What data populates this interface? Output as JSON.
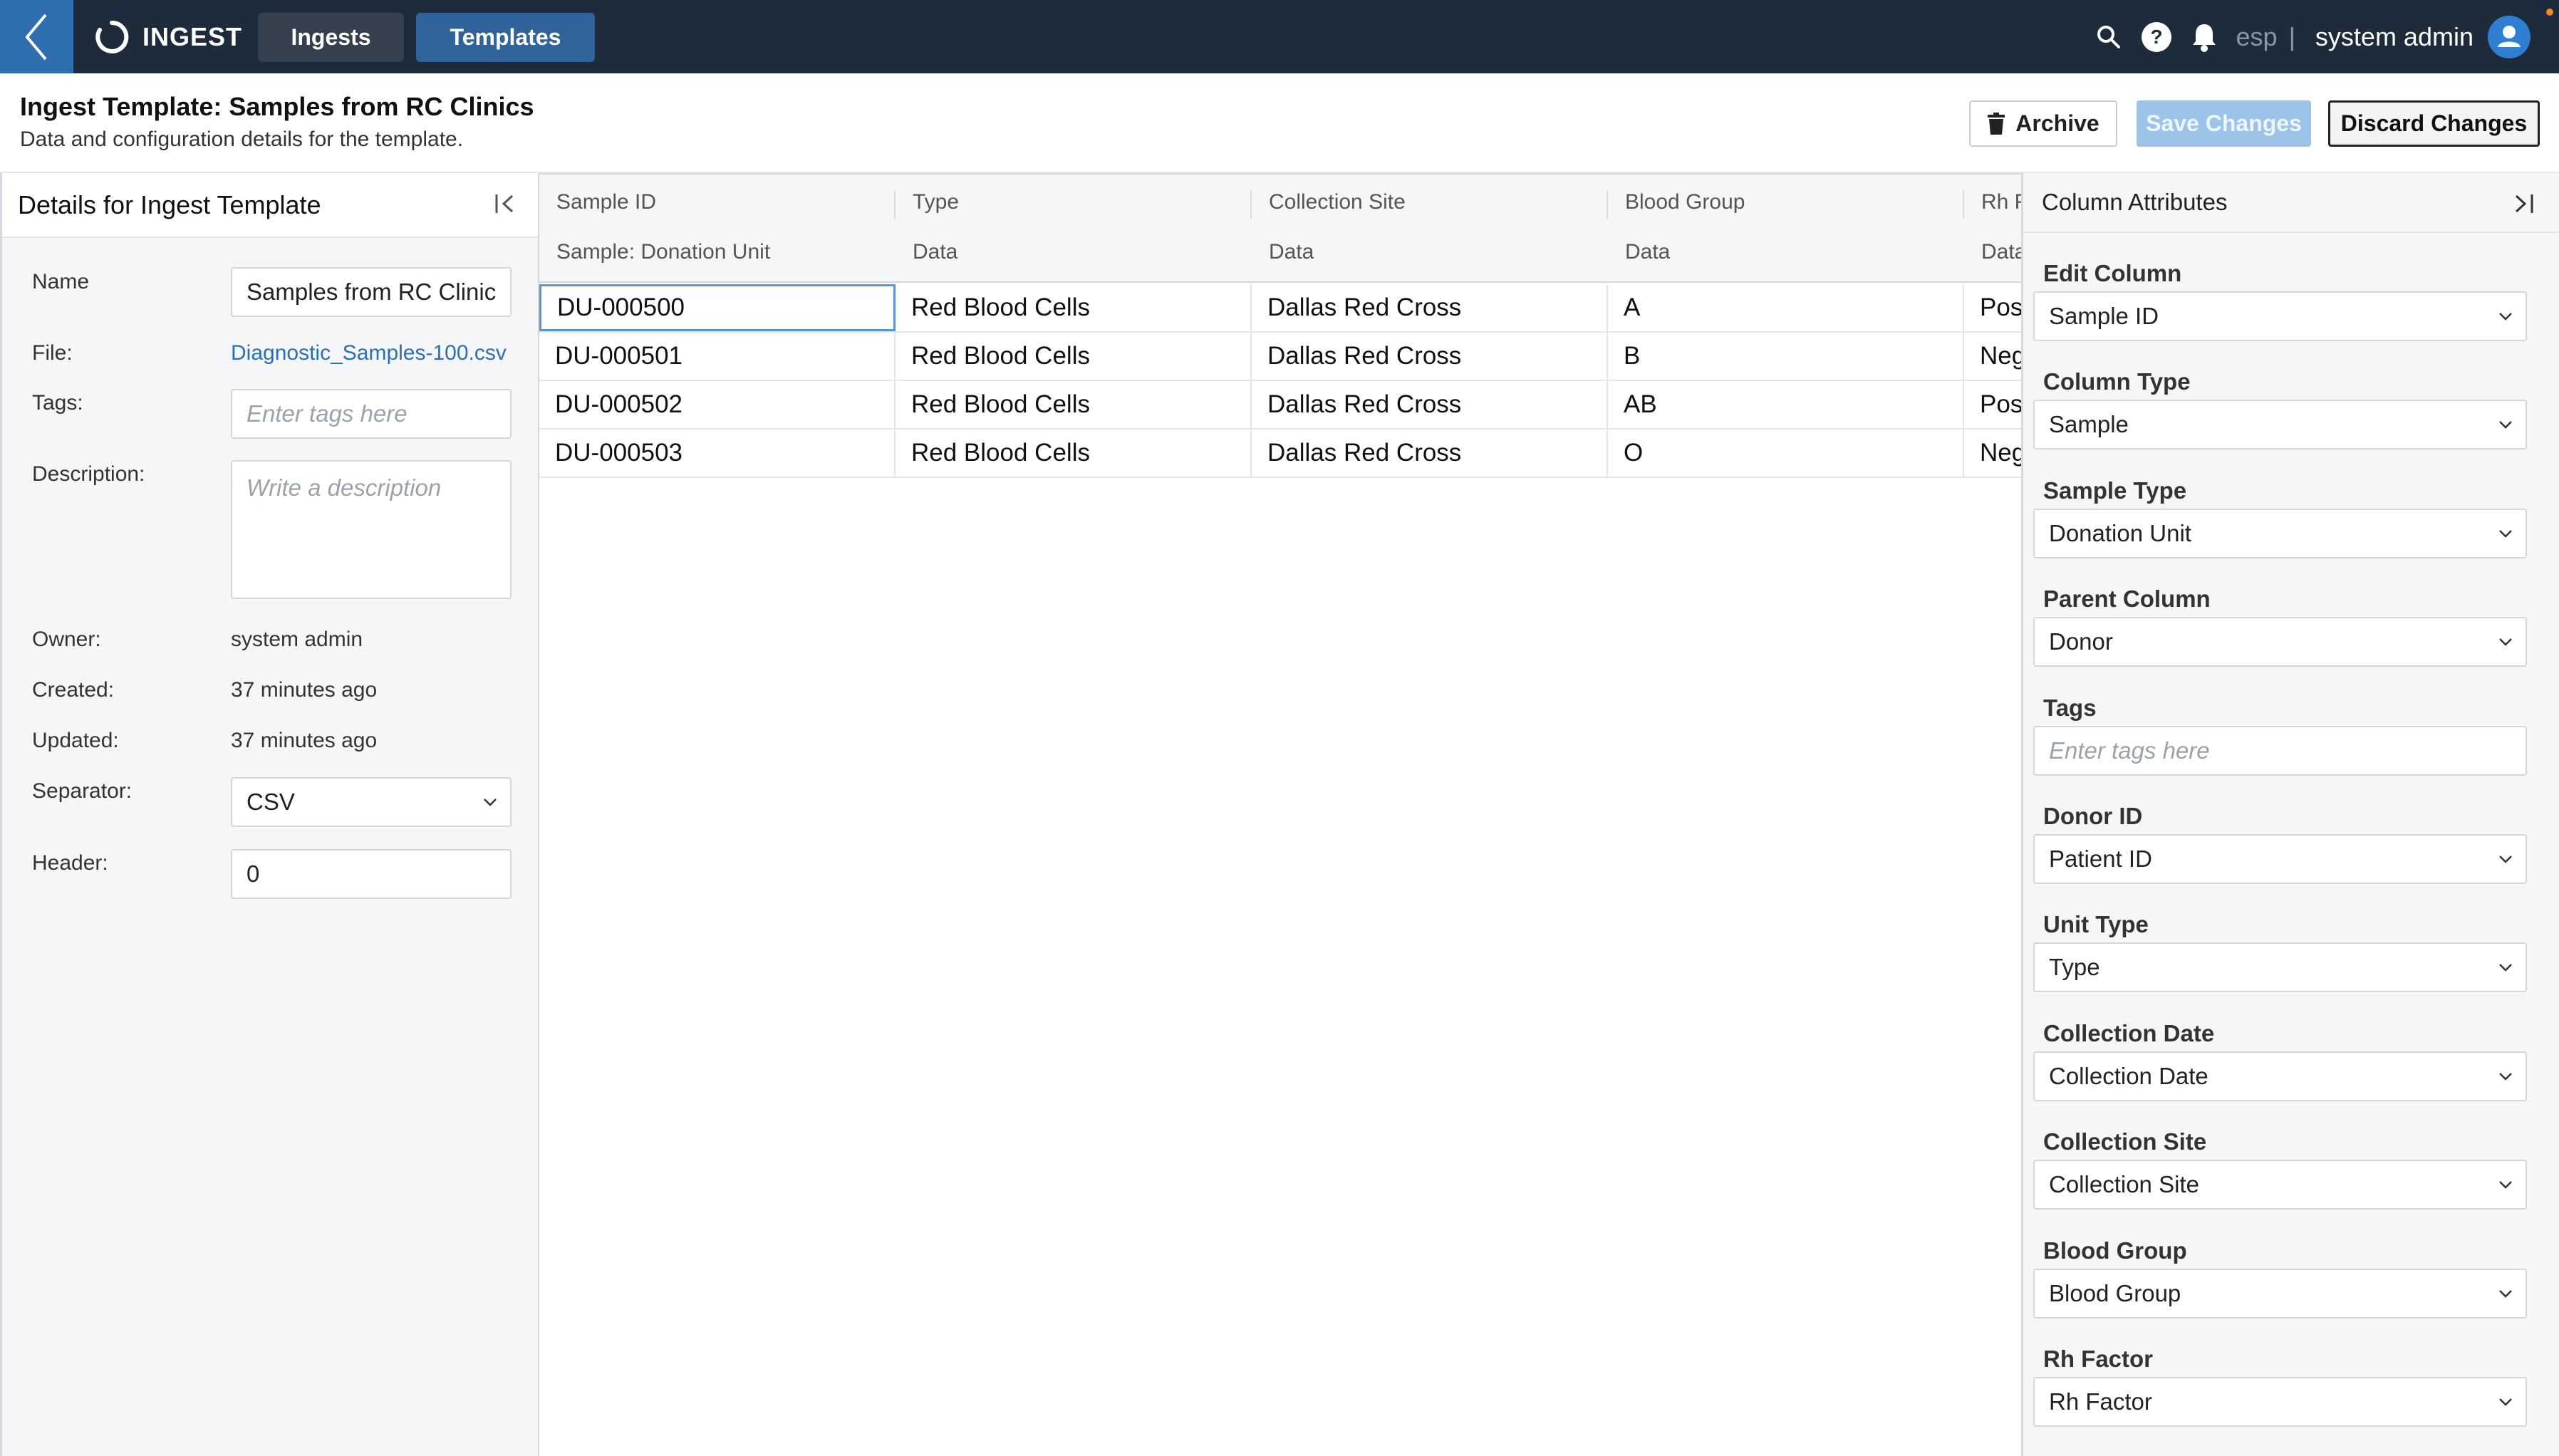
{
  "navbar": {
    "brand": "INGEST",
    "tabs": [
      {
        "label": "Ingests",
        "active": false
      },
      {
        "label": "Templates",
        "active": true
      }
    ],
    "environment": "esp",
    "separator": "|",
    "user_name": "system admin"
  },
  "page": {
    "title": "Ingest Template: Samples from RC Clinics",
    "subtitle": "Data and configuration details for the template.",
    "archive_label": "Archive",
    "save_label": "Save Changes",
    "discard_label": "Discard Changes"
  },
  "details": {
    "heading": "Details for Ingest Template",
    "name_label": "Name",
    "name_value": "Samples from RC Clinic",
    "file_label": "File:",
    "file_value": "Diagnostic_Samples-100.csv",
    "tags_label": "Tags:",
    "tags_placeholder": "Enter tags here",
    "description_label": "Description:",
    "description_placeholder": "Write a description",
    "owner_label": "Owner:",
    "owner_value": "system admin",
    "created_label": "Created:",
    "created_value": "37 minutes ago",
    "updated_label": "Updated:",
    "updated_value": "37 minutes ago",
    "separator_label": "Separator:",
    "separator_value": "CSV",
    "header_label": "Header:",
    "header_value": "0"
  },
  "grid": {
    "columns": [
      {
        "name": "Sample ID",
        "type": "Sample: Donation Unit"
      },
      {
        "name": "Type",
        "type": "Data"
      },
      {
        "name": "Collection Site",
        "type": "Data"
      },
      {
        "name": "Blood Group",
        "type": "Data"
      },
      {
        "name": "Rh Factor",
        "type": "Data"
      }
    ],
    "rows": [
      [
        "DU-000500",
        "Red Blood Cells",
        "Dallas Red Cross",
        "A",
        "Positive"
      ],
      [
        "DU-000501",
        "Red Blood Cells",
        "Dallas Red Cross",
        "B",
        "Negative"
      ],
      [
        "DU-000502",
        "Red Blood Cells",
        "Dallas Red Cross",
        "AB",
        "Positive"
      ],
      [
        "DU-000503",
        "Red Blood Cells",
        "Dallas Red Cross",
        "O",
        "Negative"
      ]
    ]
  },
  "attributes": {
    "heading": "Column Attributes",
    "fields": [
      {
        "label": "Edit Column",
        "value": "Sample ID",
        "kind": "select"
      },
      {
        "label": "Column Type",
        "value": "Sample",
        "kind": "select"
      },
      {
        "label": "Sample Type",
        "value": "Donation Unit",
        "kind": "select"
      },
      {
        "label": "Parent Column",
        "value": "Donor",
        "kind": "select"
      },
      {
        "label": "Tags",
        "value": "Enter tags here",
        "kind": "tags"
      },
      {
        "label": "Donor ID",
        "value": "Patient ID",
        "kind": "select"
      },
      {
        "label": "Unit Type",
        "value": "Type",
        "kind": "select"
      },
      {
        "label": "Collection Date",
        "value": "Collection Date",
        "kind": "select"
      },
      {
        "label": "Collection Site",
        "value": "Collection Site",
        "kind": "select"
      },
      {
        "label": "Blood Group",
        "value": "Blood Group",
        "kind": "select"
      },
      {
        "label": "Rh Factor",
        "value": "Rh Factor",
        "kind": "select"
      }
    ]
  },
  "icons": {
    "back": "chevron-left-icon",
    "logo": "ring-logo-icon",
    "search": "search-icon",
    "help": "help-icon",
    "bell": "bell-icon",
    "user": "user-avatar-icon",
    "archive": "trash-icon",
    "collapse": "collapse-left-icon",
    "expand": "collapse-right-icon",
    "caret": "chevron-down-icon"
  },
  "colors": {
    "navbar": "#1d2b3a",
    "accent": "#2f6399",
    "link": "#2c6fb5",
    "save_disabled": "#9cc3e8",
    "notification": "#f08a24"
  }
}
